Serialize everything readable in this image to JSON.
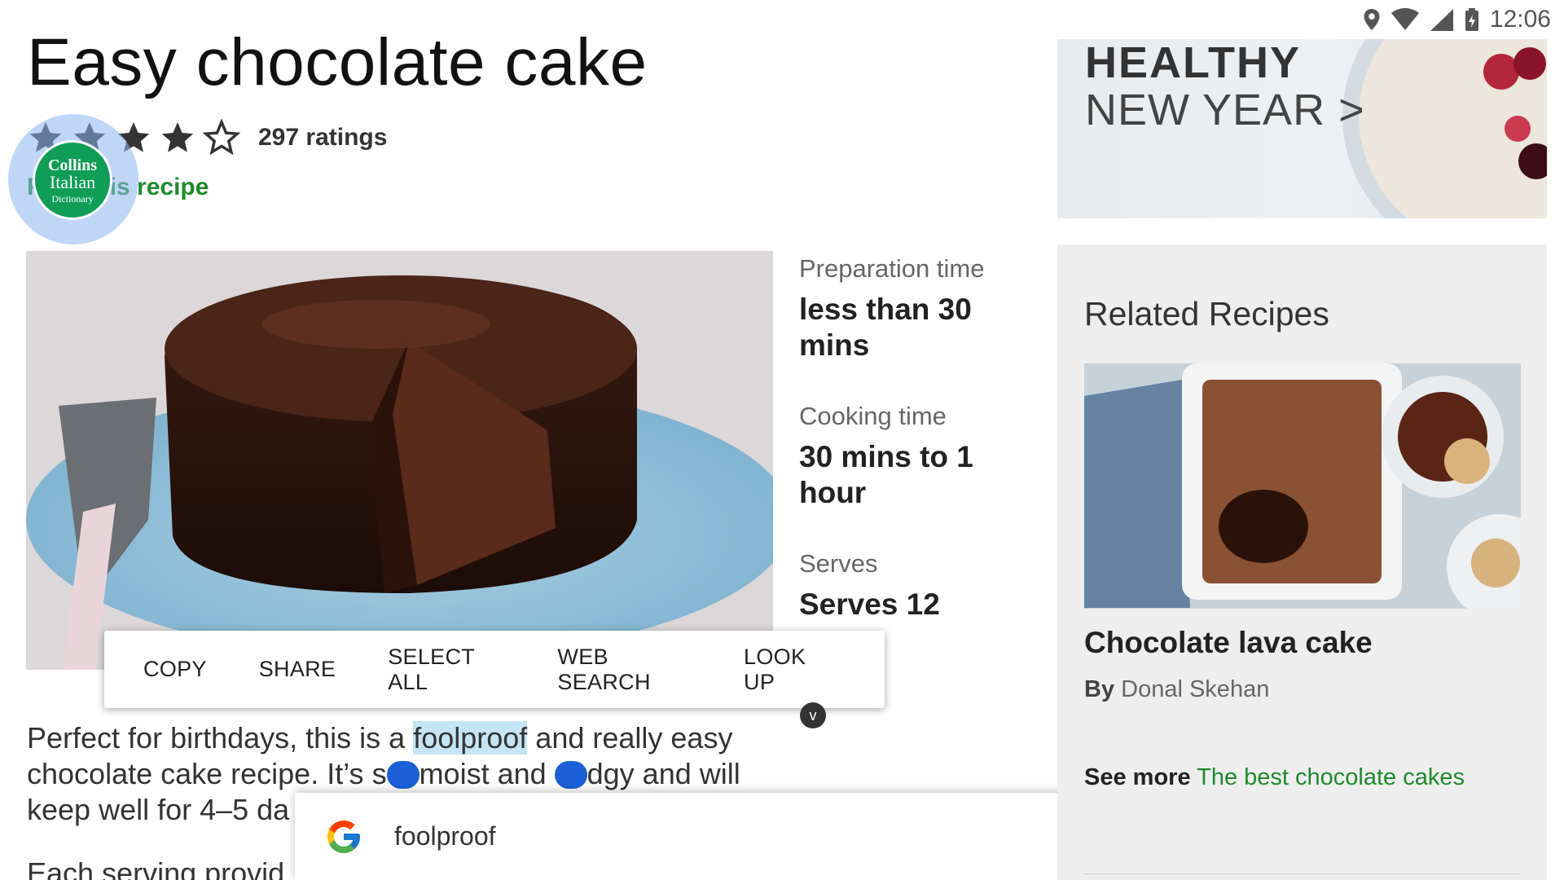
{
  "status_bar": {
    "time": "12:06"
  },
  "recipe": {
    "title": "Easy chocolate cake",
    "stars_filled": 4,
    "stars_total": 5,
    "ratings_count": "297 ratings",
    "rate_link": "Rate this recipe",
    "prep_label": "Preparation time",
    "prep_value": "less than 30 mins",
    "cook_label": "Cooking time",
    "cook_value": "30 mins to 1 hour",
    "serves_label": "Serves",
    "serves_value": "Serves 12",
    "desc_part1": "Perfect for birthdays, this is a ",
    "desc_highlight": "foolproof",
    "desc_part2": " and really easy",
    "desc_line2a": "chocolate cake recipe. It’s s",
    "desc_line2b": "moist and ",
    "desc_line2c": "dgy and will",
    "desc_line3": "keep well for 4–5 da",
    "desc_line4": "Each serving provid"
  },
  "collins": {
    "line1": "Collins",
    "line2": "Italian",
    "line3": "Dictionary"
  },
  "context_menu": [
    "COPY",
    "SHARE",
    "SELECT ALL",
    "WEB SEARCH",
    "LOOK UP"
  ],
  "context_menu_badge": "v",
  "google_sheet": {
    "query": "foolproof"
  },
  "promo": {
    "line1": "HEALTHY",
    "line2": "NEW YEAR >"
  },
  "related": {
    "heading": "Related Recipes",
    "title": "Chocolate lava cake",
    "by_label": "By",
    "author": "Donal Skehan",
    "see_more_label": "See more",
    "see_more_link": "The best chocolate cakes"
  },
  "colors": {
    "link_green": "#1e8a2d",
    "selection_blue": "#1a5fd8",
    "highlight": "#c5e5f5"
  }
}
